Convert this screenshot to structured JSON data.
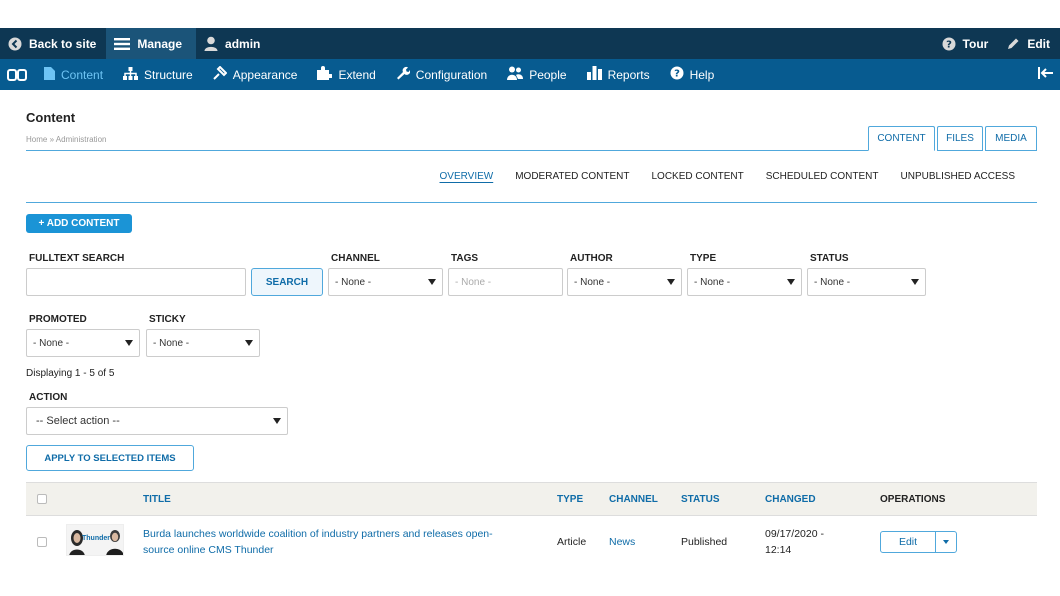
{
  "toolbar": {
    "back_label": "Back to site",
    "manage_label": "Manage",
    "user_label": "admin",
    "tour_label": "Tour",
    "edit_label": "Edit"
  },
  "tray": {
    "items": [
      {
        "label": "Content",
        "icon": "content-icon",
        "active": true
      },
      {
        "label": "Structure",
        "icon": "structure-icon"
      },
      {
        "label": "Appearance",
        "icon": "appearance-icon"
      },
      {
        "label": "Extend",
        "icon": "extend-icon"
      },
      {
        "label": "Configuration",
        "icon": "configuration-icon"
      },
      {
        "label": "People",
        "icon": "people-icon"
      },
      {
        "label": "Reports",
        "icon": "reports-icon"
      },
      {
        "label": "Help",
        "icon": "help-icon"
      }
    ]
  },
  "page": {
    "title": "Content",
    "breadcrumb": "Home » Administration"
  },
  "primary_tabs": [
    "CONTENT",
    "FILES",
    "MEDIA"
  ],
  "secondary_tabs": [
    "OVERVIEW",
    "MODERATED CONTENT",
    "LOCKED CONTENT",
    "SCHEDULED CONTENT",
    "UNPUBLISHED ACCESS"
  ],
  "add_content_label": "+ ADD CONTENT",
  "filters": {
    "fulltext_label": "FULLTEXT SEARCH",
    "search_button": "SEARCH",
    "channel_label": "CHANNEL",
    "channel_value": "- None -",
    "tags_label": "TAGS",
    "tags_placeholder": "- None -",
    "author_label": "AUTHOR",
    "author_value": "- None -",
    "type_label": "TYPE",
    "type_value": "- None -",
    "status_label": "STATUS",
    "status_value": "- None -",
    "promoted_label": "PROMOTED",
    "promoted_value": "- None -",
    "sticky_label": "STICKY",
    "sticky_value": "- None -"
  },
  "displaying": "Displaying 1 - 5 of 5",
  "action": {
    "label": "ACTION",
    "value": "-- Select action --",
    "apply_label": "APPLY TO SELECTED ITEMS"
  },
  "table": {
    "headers": {
      "title": "TITLE",
      "type": "TYPE",
      "channel": "CHANNEL",
      "status": "STATUS",
      "changed": "CHANGED",
      "operations": "OPERATIONS"
    },
    "rows": [
      {
        "thumbnail_text": "Thunder",
        "title_line1": "Burda launches worldwide coalition of industry partners and releases open-",
        "title_line2": "source online CMS Thunder",
        "type": "Article",
        "channel": "News",
        "status": "Published",
        "changed_line1": "09/17/2020 -",
        "changed_line2": "12:14",
        "operation": "Edit"
      }
    ]
  }
}
